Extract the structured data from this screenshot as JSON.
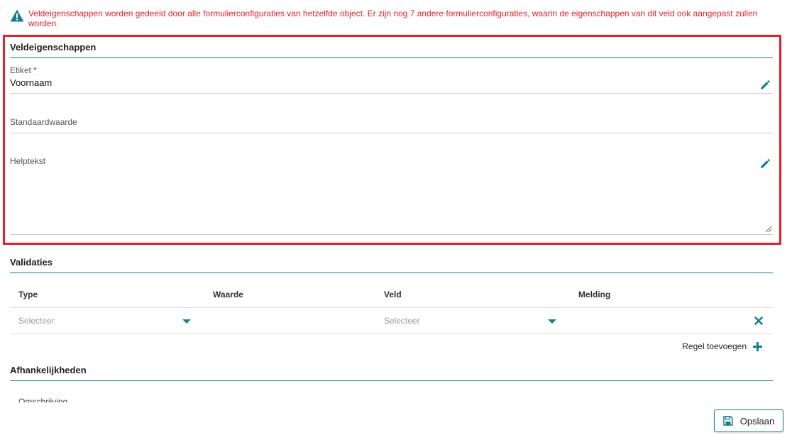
{
  "warning": {
    "text": "Veldeigenschappen worden gedeeld door alle formulierconfiguraties van hetzelfde object. Er zijn nog 7 andere formulierconfiguraties, waarin de eigenschappen van dit veld ook aangepast zullen worden.",
    "icon": "warning-triangle-icon",
    "color": "#e0202a"
  },
  "field_properties": {
    "title": "Veldeigenschappen",
    "label_field": {
      "label": "Etiket",
      "required_mark": "*",
      "value": "Voornaam"
    },
    "default_field": {
      "label": "Standaardwaarde"
    },
    "help_field": {
      "label": "Helptekst"
    }
  },
  "validations": {
    "title": "Validaties",
    "columns": [
      "Type",
      "Waarde",
      "Veld",
      "Melding"
    ],
    "row": {
      "type_placeholder": "Selecteer",
      "field_placeholder": "Selecteer"
    },
    "add_rule_label": "Regel toevoegen"
  },
  "dependencies": {
    "title": "Afhankelijkheden",
    "clipped_label": "Omschrijving"
  },
  "save_button": {
    "label": "Opslaan",
    "icon": "floppy-disk-icon"
  },
  "colors": {
    "accent": "#13808c",
    "highlight": "#e3202b"
  }
}
